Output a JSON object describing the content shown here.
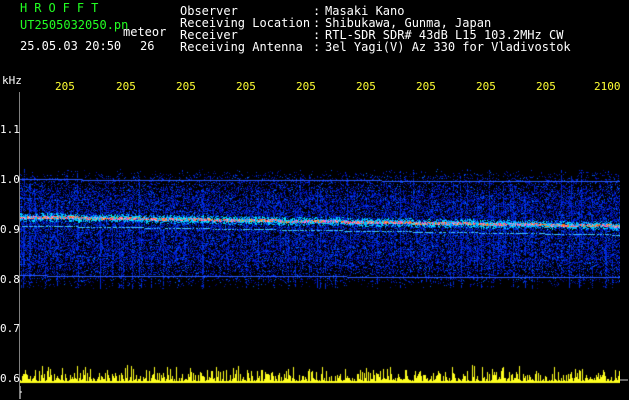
{
  "header": {
    "brand": "HROFFT",
    "file_name": "UT2505032050.pn",
    "meteor_label": "meteor",
    "datetime": "25.05.03 20:50",
    "meteor_count": "26"
  },
  "info": [
    {
      "key": "Observer",
      "value": "Masaki Kano"
    },
    {
      "key": "Receiving Location",
      "value": "Shibukawa, Gunma, Japan"
    },
    {
      "key": "Receiver",
      "value": "RTL-SDR SDR# 43dB L15 103.2MHz CW"
    },
    {
      "key": "Receiving Antenna",
      "value": "3el Yagi(V) Az 330 for Vladivostok"
    }
  ],
  "axis": {
    "unit": "kHz",
    "y_ticks": [
      "1.1",
      "1.0",
      "0.9",
      "0.8",
      "0.7",
      "0.6"
    ],
    "x_ticks": [
      "205",
      "205",
      "205",
      "205",
      "205",
      "205",
      "205",
      "205",
      "205",
      "2100"
    ]
  },
  "colors": {
    "background": "#000000",
    "text_green": "#22ff22",
    "text_white": "#ffffff",
    "tick_yellow": "#ffff33",
    "signal_low": "#1c2fd8",
    "signal_high": "#ff3a1a"
  },
  "bands_khz": {
    "carrier": 0.915,
    "upper_line": 0.998,
    "lower_line": 0.805,
    "noise_range": [
      0.78,
      1.02
    ]
  }
}
